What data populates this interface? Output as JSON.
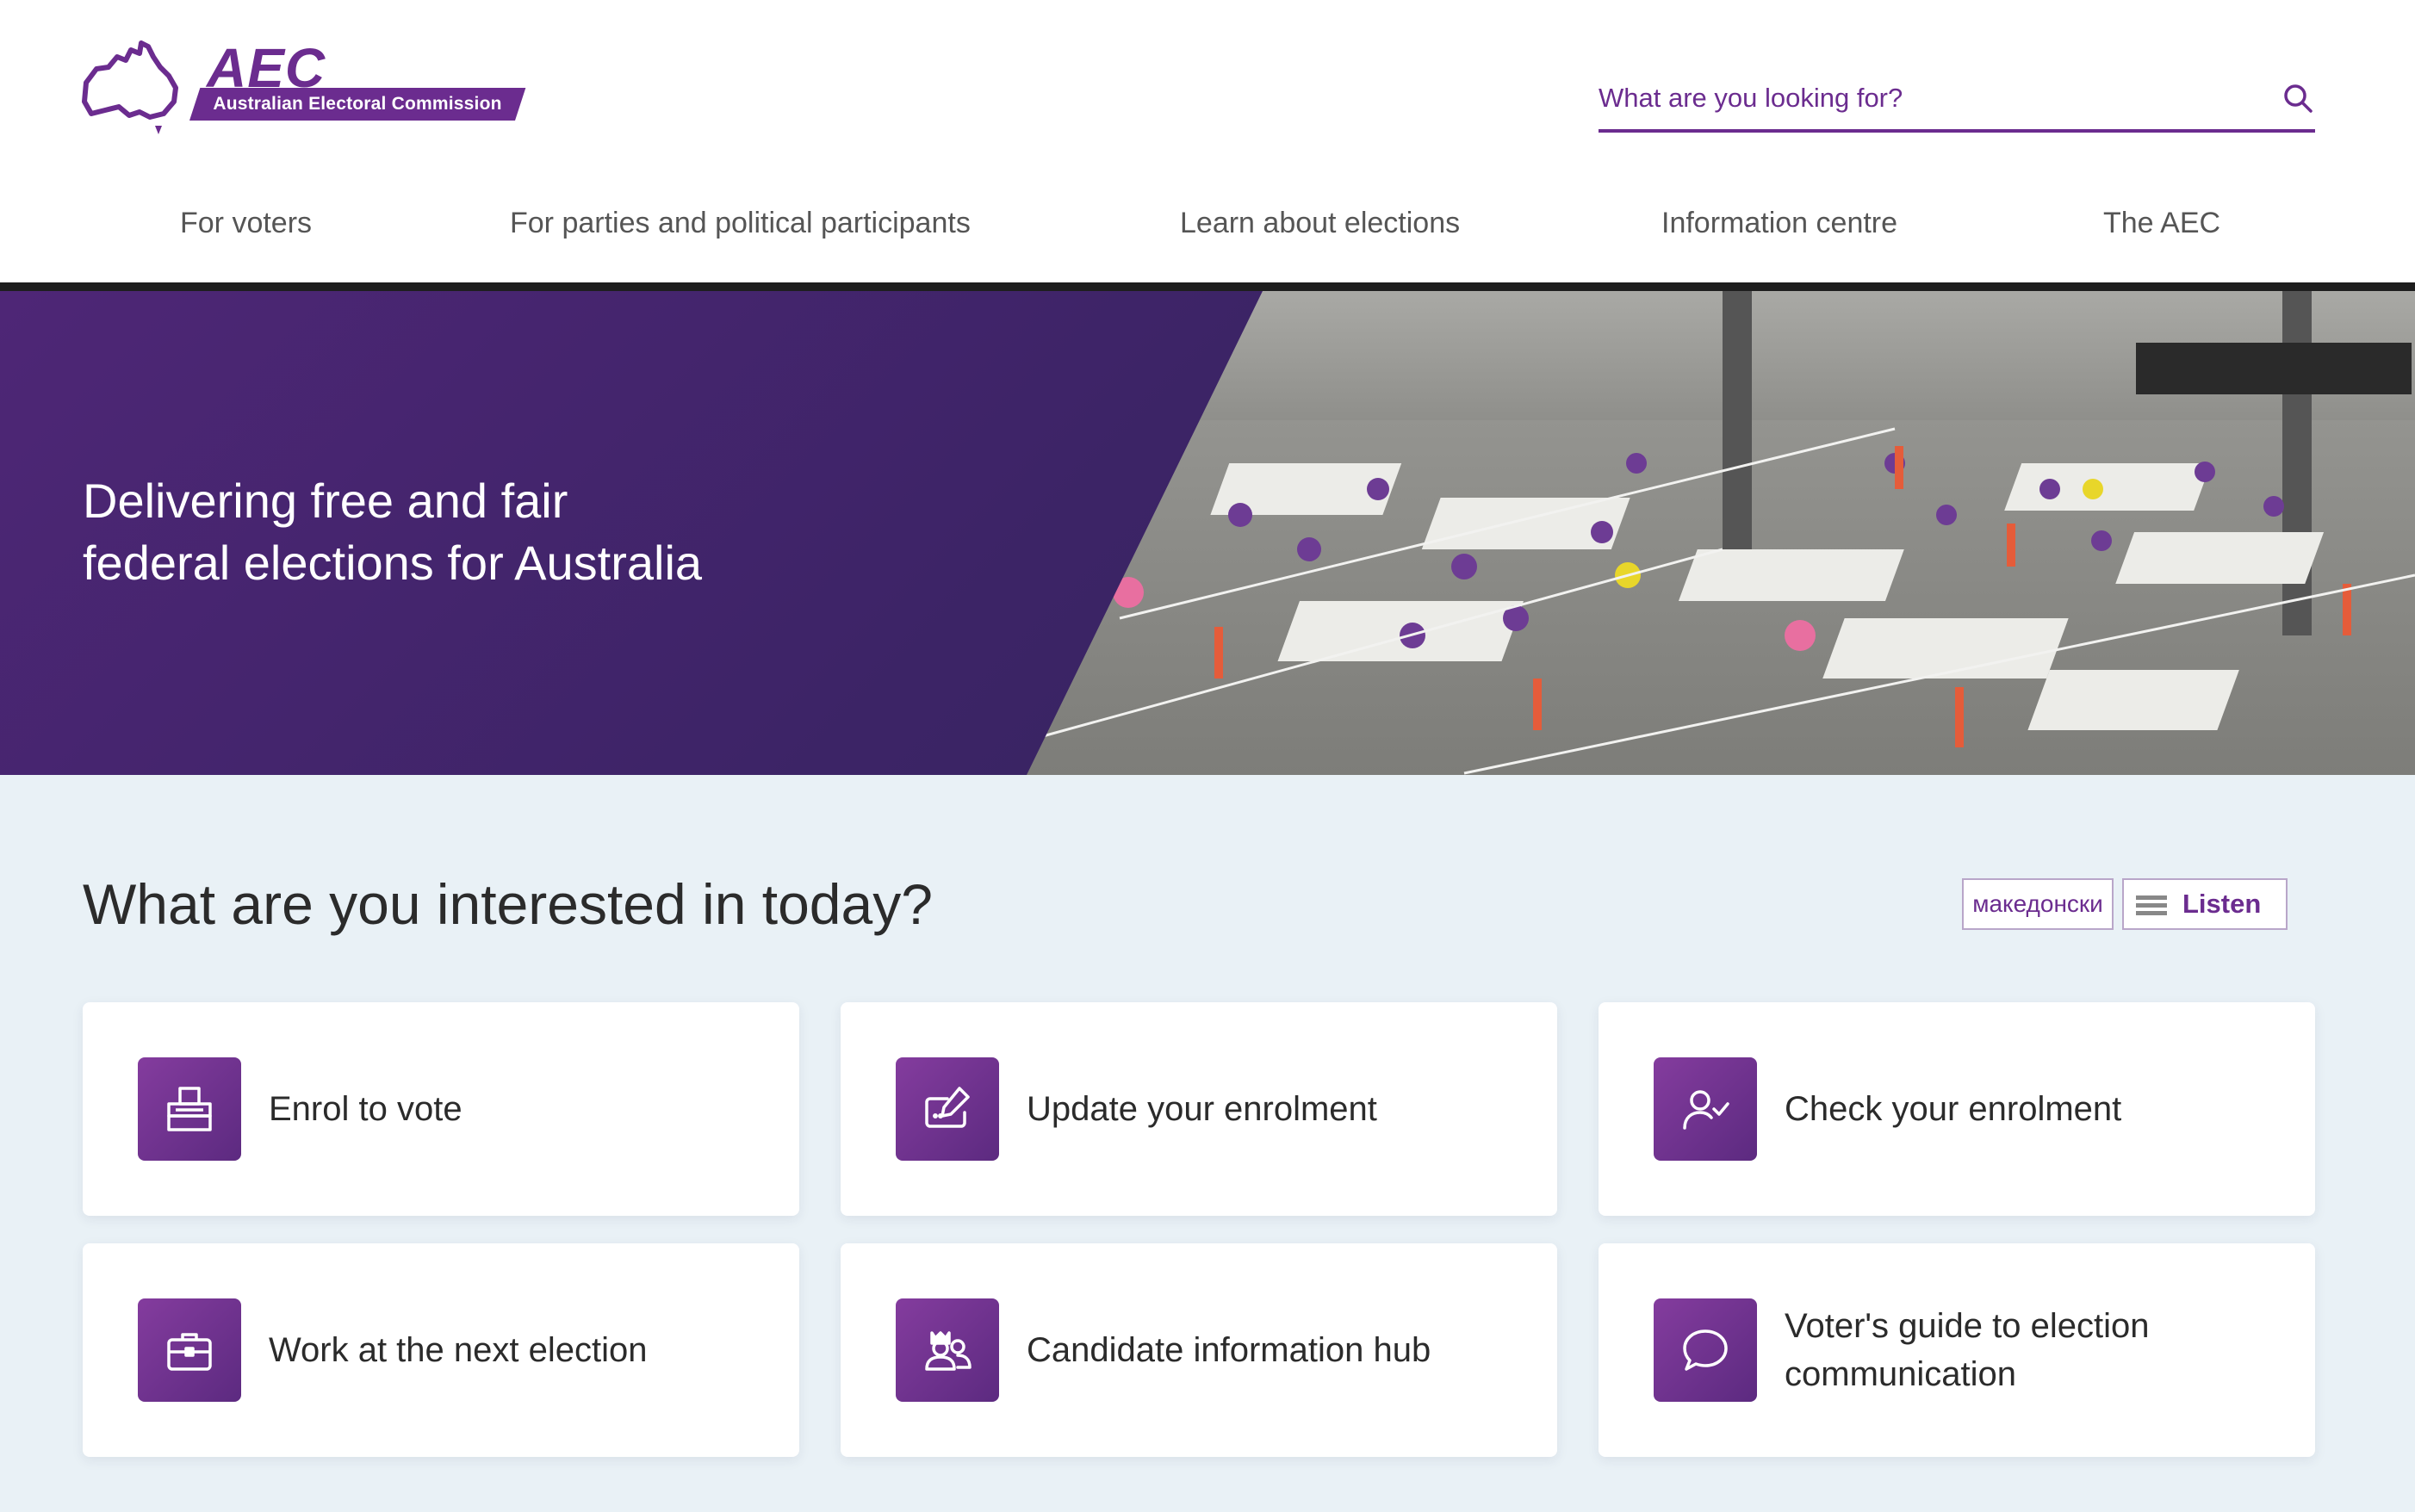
{
  "brand": {
    "acronym": "AEC",
    "name": "Australian Electoral Commission",
    "color": "#6b2c8f"
  },
  "search": {
    "placeholder": "What are you looking for?",
    "icon": "search-icon"
  },
  "nav": {
    "items": [
      {
        "label": "For voters"
      },
      {
        "label": "For parties and political participants"
      },
      {
        "label": "Learn about elections"
      },
      {
        "label": "Information centre"
      },
      {
        "label": "The AEC"
      }
    ]
  },
  "hero": {
    "line1": "Delivering free and fair",
    "line2": "federal elections for Australia",
    "image": "vote-counting-centre-photo"
  },
  "main": {
    "title": "What are you interested in today?",
    "language_button": "македонски",
    "listen_button": "Listen"
  },
  "cards": [
    {
      "label": "Enrol to vote",
      "icon": "ballot-box-icon"
    },
    {
      "label": "Update your enrolment",
      "icon": "edit-form-icon"
    },
    {
      "label": "Check your enrolment",
      "icon": "user-check-icon"
    },
    {
      "label": "Work at the next election",
      "icon": "briefcase-icon"
    },
    {
      "label": "Candidate information hub",
      "icon": "candidates-icon"
    },
    {
      "label": "Voter's guide to election communication",
      "icon": "speech-bubble-icon"
    }
  ],
  "colors": {
    "accent": "#6b2c8f",
    "hero_panel": "#3c2466",
    "page_background": "#e9f1f6",
    "card_background": "#ffffff"
  }
}
